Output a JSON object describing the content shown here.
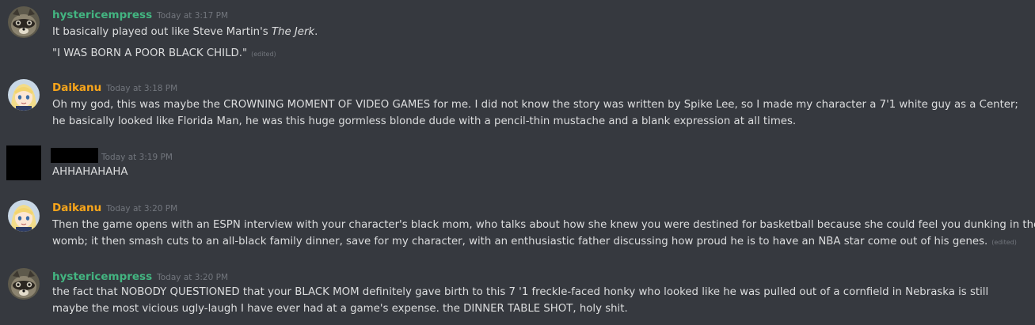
{
  "messages": [
    {
      "username": "hystericempress",
      "timestamp": "Today at 3:17 PM",
      "lines": [
        {
          "before": "It basically played out like Steve Martin's ",
          "italic": "The Jerk",
          "after": "."
        },
        {
          "text": "\"I WAS BORN A POOR BLACK CHILD.\"",
          "edited": "(edited)"
        }
      ]
    },
    {
      "username": "Daikanu",
      "timestamp": "Today at 3:18 PM",
      "lines": [
        {
          "text": "Oh my god, this was maybe the CROWNING MOMENT OF VIDEO GAMES for me. I did not know the story was written by Spike Lee, so I made my character a 7'1 white guy as a Center;"
        },
        {
          "text": "he basically looked like Florida Man, he was this huge gormless blonde dude with a pencil-thin mustache and a blank expression at all times."
        }
      ]
    },
    {
      "username": "",
      "timestamp": "Today at 3:19 PM",
      "lines": [
        {
          "text": "AHHAHAHAHA"
        }
      ]
    },
    {
      "username": "Daikanu",
      "timestamp": "Today at 3:20 PM",
      "lines": [
        {
          "text": "Then the game opens with an ESPN interview with your character's black mom, who talks about how she knew you were destined for basketball because she could feel you dunking in the"
        },
        {
          "text": "womb; it then smash cuts to an all-black family dinner, save for my character, with an enthusiastic father discussing how proud he is to have an NBA star come out of his genes.",
          "edited": "(edited)"
        }
      ]
    },
    {
      "username": "hystericempress",
      "timestamp": "Today at 3:20 PM",
      "lines": [
        {
          "text": "the fact that NOBODY QUESTIONED that your BLACK MOM definitely gave birth to this 7 '1 freckle-faced honky who looked like he was pulled out of a cornfield in Nebraska is still"
        },
        {
          "text": "maybe the most vicious ugly-laugh I have ever had at a game's expense. the DINNER TABLE SHOT, holy shit."
        }
      ]
    }
  ],
  "colors": {
    "background": "#36393f",
    "text": "#dcddde",
    "timestamp": "#72767d",
    "username_hystericempress": "#43b581",
    "username_daikanu": "#faa61a"
  },
  "icons": {
    "avatar_hystericempress": "raccoon-avatar-icon",
    "avatar_daikanu": "anime-girl-avatar-icon",
    "avatar_redacted": "redacted-avatar"
  }
}
